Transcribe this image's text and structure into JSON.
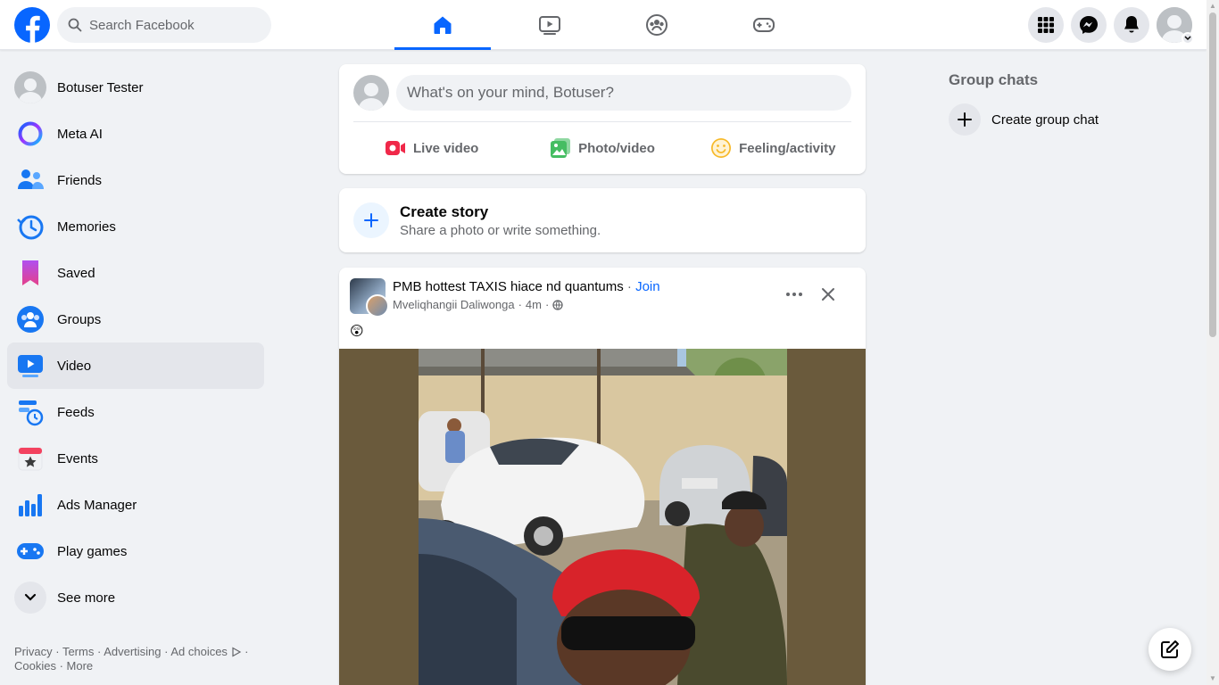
{
  "header": {
    "search_placeholder": "Search Facebook",
    "tabs": [
      "Home",
      "Video",
      "Groups",
      "Gaming"
    ],
    "active_tab": "Home",
    "accent_color": "#0866ff"
  },
  "sidebar": {
    "items": [
      {
        "label": "Botuser Tester",
        "icon": "profile-avatar"
      },
      {
        "label": "Meta AI",
        "icon": "meta-ai-icon"
      },
      {
        "label": "Friends",
        "icon": "friends-icon"
      },
      {
        "label": "Memories",
        "icon": "memories-icon"
      },
      {
        "label": "Saved",
        "icon": "saved-icon"
      },
      {
        "label": "Groups",
        "icon": "groups-icon"
      },
      {
        "label": "Video",
        "icon": "video-icon"
      },
      {
        "label": "Feeds",
        "icon": "feeds-icon"
      },
      {
        "label": "Events",
        "icon": "events-icon"
      },
      {
        "label": "Ads Manager",
        "icon": "ads-manager-icon"
      },
      {
        "label": "Play games",
        "icon": "play-games-icon"
      },
      {
        "label": "See more",
        "icon": "chevron-down-icon"
      }
    ],
    "active_item": "Video",
    "footer": {
      "privacy": "Privacy",
      "terms": "Terms",
      "advertising": "Advertising",
      "ad_choices": "Ad choices",
      "cookies": "Cookies",
      "more": "More"
    }
  },
  "composer": {
    "placeholder": "What's on your mind, Botuser?",
    "live_video": "Live video",
    "photo_video": "Photo/video",
    "feeling_activity": "Feeling/activity"
  },
  "story": {
    "title": "Create story",
    "subtitle": "Share a photo or write something."
  },
  "post": {
    "group_name": "PMB hottest TAXIS hiace nd quantums",
    "separator": "·",
    "join_label": "Join",
    "author": "Mveliqhangii Daliwonga",
    "time": "4m",
    "audience_icon": "globe-icon",
    "text": "😲"
  },
  "right": {
    "heading": "Group chats",
    "create_label": "Create group chat"
  }
}
